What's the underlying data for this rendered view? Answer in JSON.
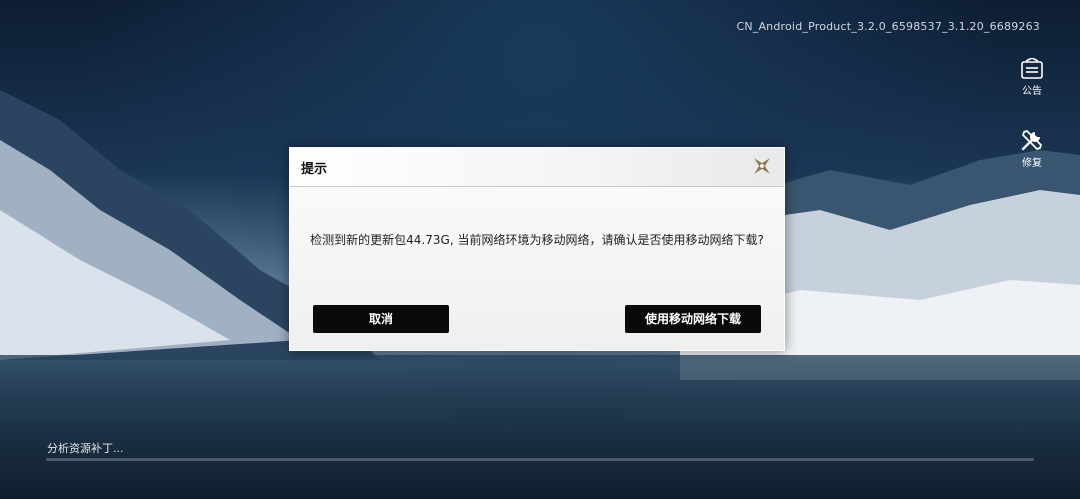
{
  "version": "CN_Android_Product_3.2.0_6598537_3.1.20_6689263",
  "side_buttons": {
    "notice": {
      "label": "公告",
      "icon": "notice-board-icon"
    },
    "repair": {
      "label": "修复",
      "icon": "wrench-screwdriver-icon"
    }
  },
  "dialog": {
    "title": "提示",
    "message": "检测到新的更新包44.73G, 当前网络环境为移动网络，请确认是否使用移动网络下载?",
    "cancel_label": "取消",
    "confirm_label": "使用移动网络下载",
    "close_icon": "close-star-icon"
  },
  "status": {
    "text": "分析资源补丁...",
    "progress": 0
  },
  "colors": {
    "button_bg": "#0a0a0a",
    "dialog_bg": "#f2f2f2",
    "close_icon": "#8a7a55"
  }
}
